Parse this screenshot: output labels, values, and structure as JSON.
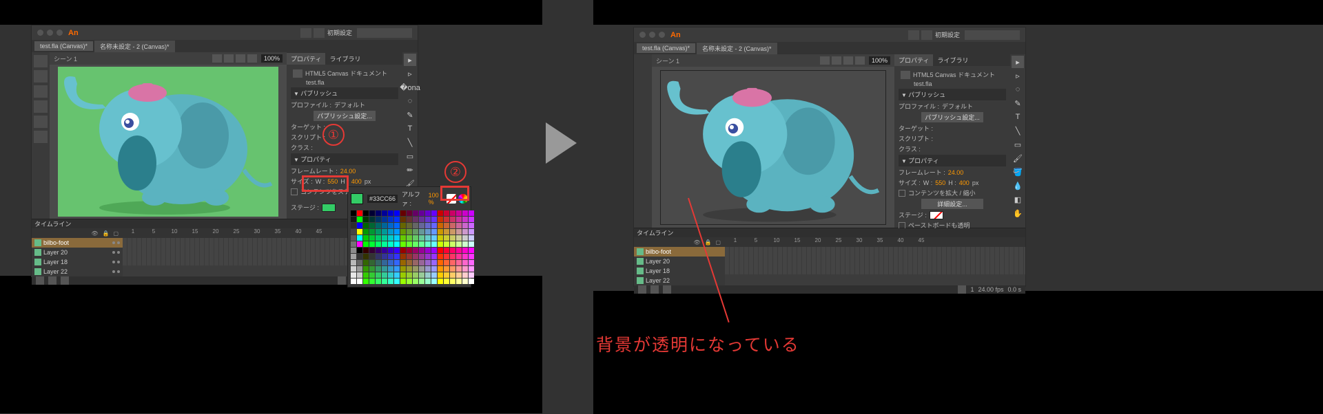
{
  "app": {
    "icon": "An",
    "workspace": "初期設定"
  },
  "left": {
    "tabs": [
      "test.fla (Canvas)*",
      "名称未設定 - 2 (Canvas)*"
    ],
    "scene": "シーン 1",
    "zoom": "100%",
    "stage_color": "#33CC66"
  },
  "right": {
    "tabs": [
      "test.fla (Canvas)*",
      "名称未設定 - 2 (Canvas)*"
    ],
    "scene": "シーン 1",
    "zoom": "100%"
  },
  "properties": {
    "tab1": "プロパティ",
    "tab2": "ライブラリ",
    "doc_type": "HTML5 Canvas ドキュメント",
    "doc_name": "test.fla",
    "sect_publish": "パブリッシュ",
    "profile_label": "プロファイル :",
    "profile_value": "デフォルト",
    "publish_btn": "パブリッシュ設定...",
    "target_label": "ターゲット :",
    "script_label": "スクリプト :",
    "class_label": "クラス :",
    "sect_props": "プロパティ",
    "fps_label": "フレームレート :",
    "fps_value": "24.00",
    "size_label": "サイズ :",
    "w_label": "W :",
    "w_value": "550",
    "h_label": "H :",
    "h_value": "400",
    "px": "px",
    "scale_content": "コンテンツをスケール／アート",
    "scale_content2": "コンテンツを拡大 / 縮小",
    "advanced_btn": "詳細設定...",
    "stage_label": "ステージ :",
    "pasteboard": "ペーストボードも透明"
  },
  "timeline": {
    "tab": "タイムライン",
    "layers": [
      "bilbo-foot",
      "Layer 20",
      "Layer 18",
      "Layer 22"
    ],
    "frames": [
      "1",
      "5",
      "10",
      "15",
      "20",
      "25",
      "30",
      "35",
      "40",
      "45"
    ],
    "footer_fps": "24.00 fps",
    "footer_time": "0.0 s",
    "footer_frame": "1"
  },
  "colorpicker": {
    "hex": "#33CC66",
    "alpha_label": "アルファ :",
    "alpha_value": "100 %"
  },
  "annotations": {
    "n1": "①",
    "n2": "②",
    "caption": "背景が透明になっている"
  }
}
